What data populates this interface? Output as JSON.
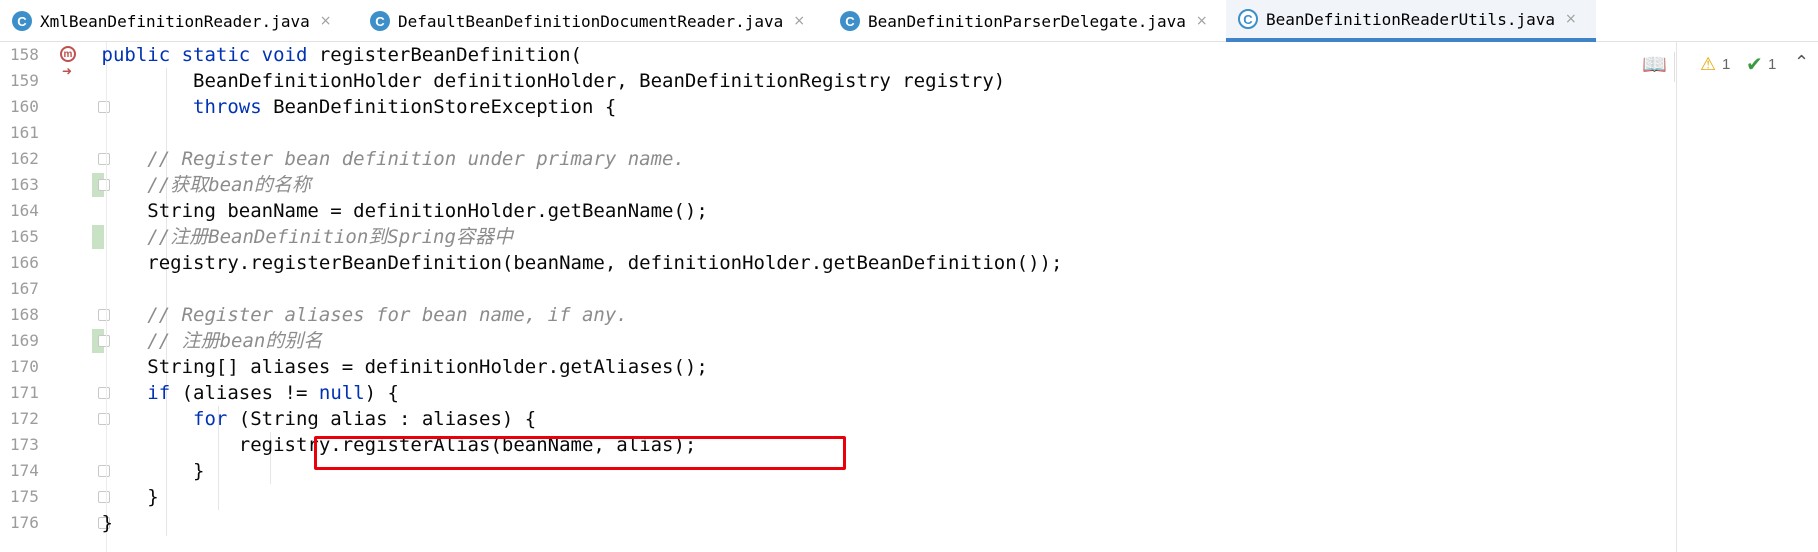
{
  "tabs": [
    {
      "label": "XmlBeanDefinitionReader.java",
      "icon": "class-icon"
    },
    {
      "label": "DefaultBeanDefinitionDocumentReader.java",
      "icon": "class-icon"
    },
    {
      "label": "BeanDefinitionParserDelegate.java",
      "icon": "class-icon"
    },
    {
      "label": "BeanDefinitionReaderUtils.java",
      "icon": "class-icon",
      "active": true
    }
  ],
  "tab_icon_letter": "C",
  "tab_close_glyph": "×",
  "method_marker_letter": "m",
  "line_numbers": [
    "158",
    "159",
    "160",
    "161",
    "162",
    "163",
    "164",
    "165",
    "166",
    "167",
    "168",
    "169",
    "170",
    "171",
    "172",
    "173",
    "174",
    "175",
    "176"
  ],
  "code": {
    "l158": {
      "indent": "        ",
      "kw": "public static void",
      "rest": " registerBeanDefinition("
    },
    "l159": {
      "indent": "                ",
      "text": "BeanDefinitionHolder definitionHolder, BeanDefinitionRegistry registry)"
    },
    "l160": {
      "indent": "                ",
      "kw": "throws",
      "rest": " BeanDefinitionStoreException {"
    },
    "l162": {
      "indent": "            ",
      "comment": "// Register bean definition under primary name."
    },
    "l163": {
      "indent": "            ",
      "comment": "//获取bean的名称"
    },
    "l164": {
      "indent": "            ",
      "text": "String beanName = definitionHolder.getBeanName();"
    },
    "l165": {
      "indent": "            ",
      "comment": "//注册BeanDefinition到Spring容器中"
    },
    "l166": {
      "indent": "            ",
      "text": "registry.registerBeanDefinition(beanName, definitionHolder.getBeanDefinition());"
    },
    "l168": {
      "indent": "            ",
      "comment": "// Register aliases for bean name, if any."
    },
    "l169": {
      "indent": "            ",
      "comment": "// 注册bean的别名"
    },
    "l170": {
      "indent": "            ",
      "text": "String[] aliases = definitionHolder.getAliases();"
    },
    "l171": {
      "indent": "            ",
      "kw": "if",
      "mid": " (aliases != ",
      "kw2": "null",
      "rest": ") {"
    },
    "l172": {
      "indent": "                ",
      "kw": "for",
      "rest": " (String alias : aliases) {"
    },
    "l173": {
      "indent": "                    ",
      "text": "registry.registerAlias(beanName, alias);"
    },
    "l174": {
      "indent": "                ",
      "text": "}"
    },
    "l175": {
      "indent": "            ",
      "text": "}"
    },
    "l176": {
      "indent": "        ",
      "text": "}"
    }
  },
  "inspections": {
    "warnings": "1",
    "weak_warnings": "1"
  },
  "colors": {
    "keyword": "#0033b3",
    "comment": "#8c8c8c",
    "highlight": "#e8000b",
    "active_tab_underline": "#4083c9"
  }
}
